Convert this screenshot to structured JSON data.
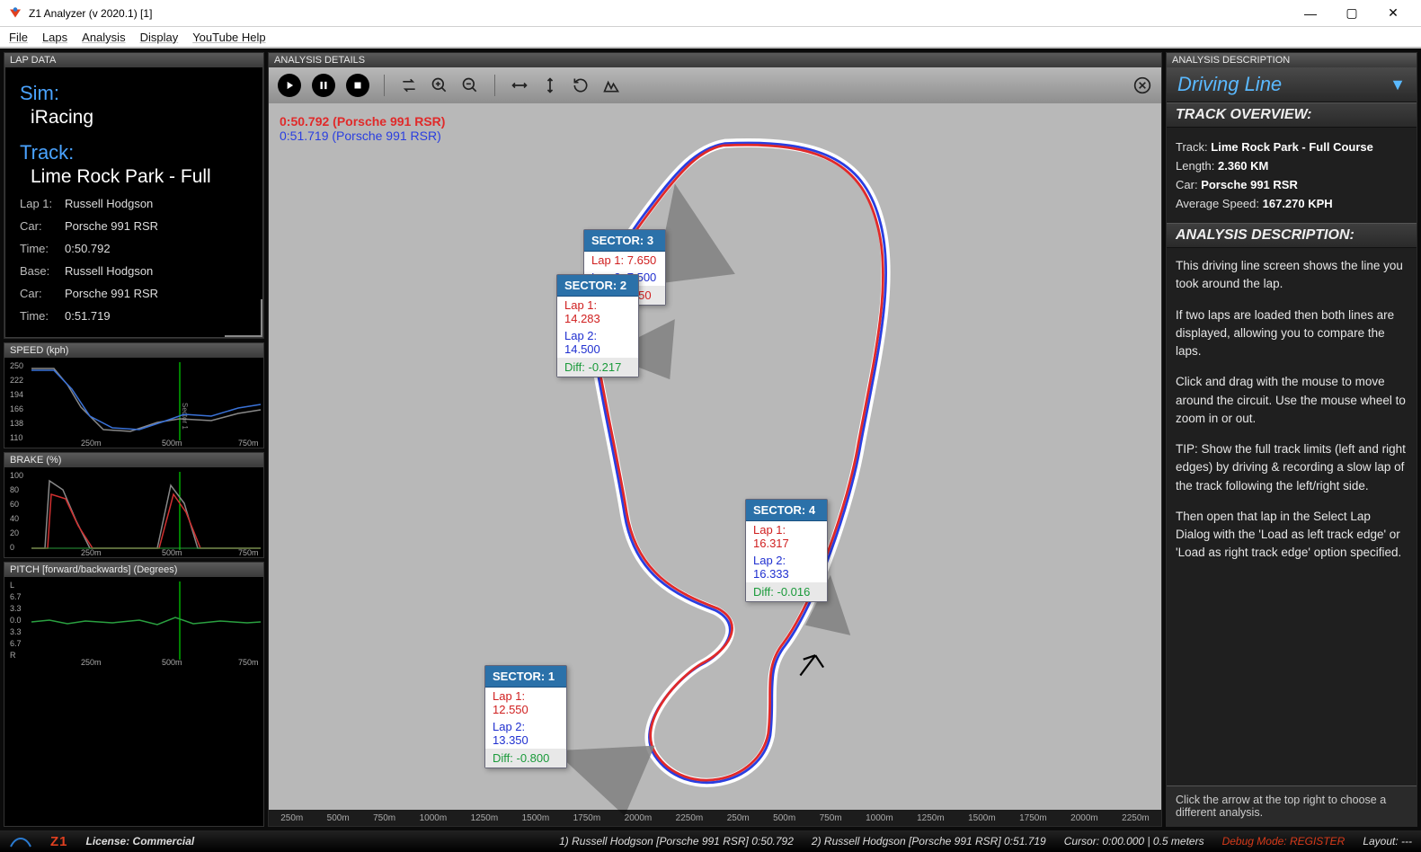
{
  "window": {
    "title": "Z1 Analyzer (v 2020.1) [1]"
  },
  "menu": [
    "File",
    "Laps",
    "Analysis",
    "Display",
    "YouTube Help"
  ],
  "lapdata": {
    "header": "LAP DATA",
    "sim_label": "Sim:",
    "sim": "iRacing",
    "track_label": "Track:",
    "track": "Lime Rock Park - Full",
    "rows": [
      {
        "k": "Lap 1:",
        "v": "Russell Hodgson"
      },
      {
        "k": "Car:",
        "v": "Porsche 991 RSR"
      },
      {
        "k": "Time:",
        "v": "0:50.792"
      },
      {
        "k": "Base:",
        "v": "Russell Hodgson"
      },
      {
        "k": "Car:",
        "v": "Porsche 991 RSR"
      },
      {
        "k": "Time:",
        "v": "0:51.719"
      }
    ]
  },
  "mini_charts": [
    {
      "title": "SPEED (kph)",
      "yticks": [
        "250",
        "222",
        "194",
        "166",
        "138",
        "110"
      ],
      "xticks": [
        "250m",
        "500m",
        "750m"
      ]
    },
    {
      "title": "BRAKE (%)",
      "yticks": [
        "100",
        "80",
        "60",
        "40",
        "20",
        "0"
      ],
      "xticks": [
        "250m",
        "500m",
        "750m"
      ]
    },
    {
      "title": "PITCH [forward/backwards] (Degrees)",
      "yticks": [
        "L",
        "6.7",
        "3.3",
        "0.0",
        "3.3",
        "6.7",
        "R"
      ],
      "xticks": [
        "250m",
        "500m",
        "750m"
      ]
    }
  ],
  "analysis": {
    "header": "ANALYSIS DETAILS",
    "legend1": "0:50.792 (Porsche 991 RSR)",
    "legend2": "0:51.719 (Porsche 991 RSR)",
    "sectors": {
      "s1": {
        "title": "SECTOR: 1",
        "lap1": "Lap 1: 12.550",
        "lap2": "Lap 2: 13.350",
        "diff": "Diff: -0.800",
        "cls": "green"
      },
      "s2": {
        "title": "SECTOR: 2",
        "lap1": "Lap 1: 14.283",
        "lap2": "Lap 2: 14.500",
        "diff": "Diff: -0.217",
        "cls": "green"
      },
      "s3": {
        "title": "SECTOR: 3",
        "lap1": "Lap 1: 7.650",
        "lap2": "Lap 2: 7.500",
        "diff": "Diff: +0.150",
        "cls": "red"
      },
      "s4": {
        "title": "SECTOR: 4",
        "lap1": "Lap 1: 16.317",
        "lap2": "Lap 2: 16.333",
        "diff": "Diff: -0.016",
        "cls": "green"
      }
    },
    "xaxis": [
      "250m",
      "500m",
      "750m",
      "1000m",
      "1250m",
      "1500m",
      "1750m",
      "2000m",
      "2250m",
      "250m",
      "500m",
      "750m",
      "1000m",
      "1250m",
      "1500m",
      "1750m",
      "2000m",
      "2250m"
    ]
  },
  "desc_panel": {
    "header": "ANALYSIS DESCRIPTION",
    "title": "Driving Line",
    "overview_h": "TRACK OVERVIEW:",
    "track_k": "Track:",
    "track_v": "Lime Rock Park - Full Course",
    "length_k": "Length:",
    "length_v": "2.360 KM",
    "car_k": "Car:",
    "car_v": "Porsche 991 RSR",
    "avgspeed_k": "Average Speed:",
    "avgspeed_v": "167.270 KPH",
    "desc_h": "ANALYSIS DESCRIPTION:",
    "p1": "This driving line screen shows the line you took around the lap.",
    "p2": "If two laps are loaded then both lines are displayed, allowing you to compare the laps.",
    "p3": "Click and drag with the mouse to move around the circuit. Use the mouse wheel to zoom in or out.",
    "p4": "TIP: Show the full track limits (left and right edges) by driving & recording a slow lap of the track following the left/right side.",
    "p5": "Then open that lap in the Select Lap Dialog with the 'Load as left track edge' or 'Load as right track edge' option specified.",
    "foot": "Click the arrow at the top right to choose a different analysis."
  },
  "status": {
    "license": "License: Commercial",
    "s1": "1) Russell Hodgson  [Porsche 991 RSR]  0:50.792",
    "s2": "2) Russell Hodgson  [Porsche 991 RSR]  0:51.719",
    "cursor": "Cursor: 0:00.000 | 0.5 meters",
    "debug": "Debug Mode: REGISTER",
    "layout": "Layout: ---"
  }
}
